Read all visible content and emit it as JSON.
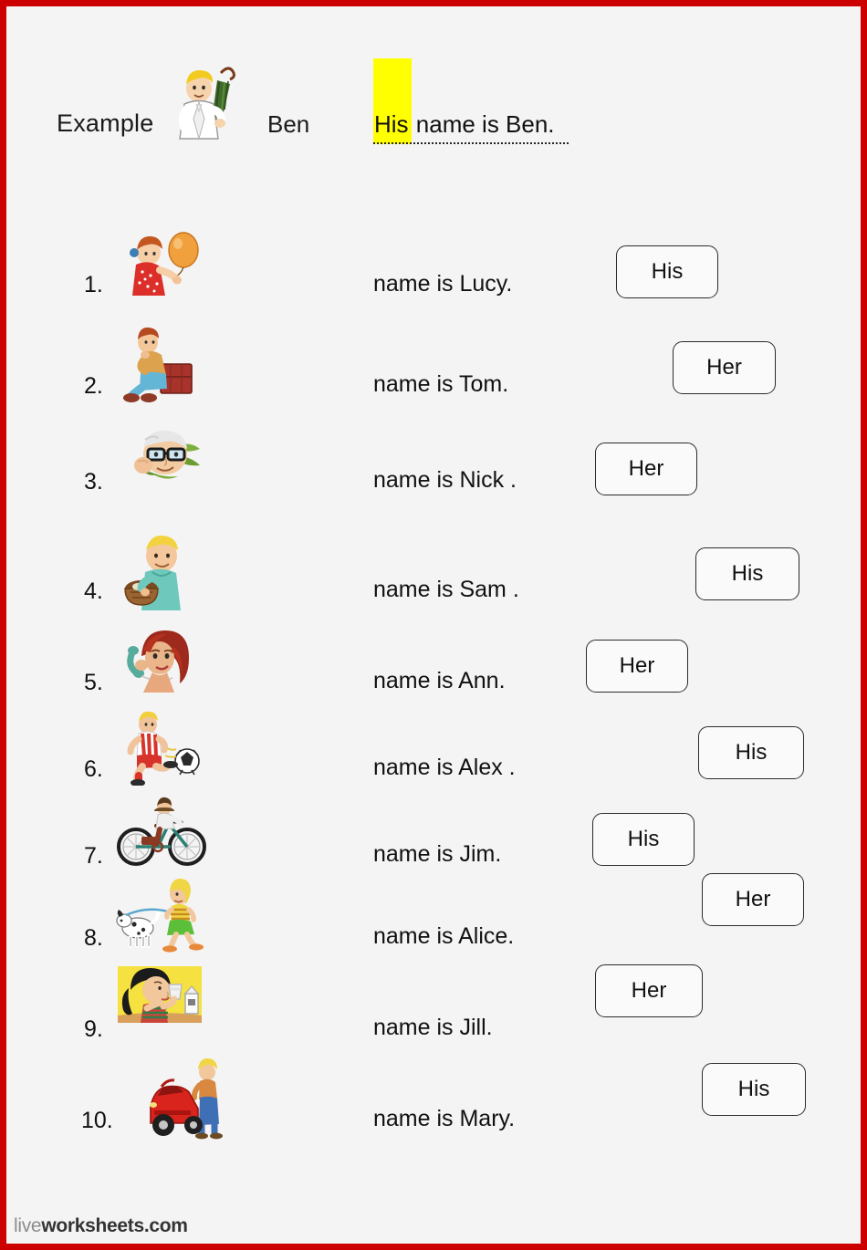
{
  "page": {
    "border_color": "#cc0000",
    "background_color": "#f4f4f4",
    "highlight_color": "#ffff00"
  },
  "example": {
    "label": "Example",
    "person_name": "Ben",
    "answer": "His",
    "sentence_rest": " name is Ben.",
    "figure": "man-with-umbrella-and-flowers"
  },
  "questions": [
    {
      "number": "1.",
      "text": "name is Lucy.",
      "answer": "His",
      "figure": "girl-with-balloon"
    },
    {
      "number": "2.",
      "text": "name is Tom.",
      "answer": "Her",
      "figure": "boy-on-suitcase"
    },
    {
      "number": "3.",
      "text": "name is Nick .",
      "answer": "Her",
      "figure": "old-man-with-glasses"
    },
    {
      "number": "4.",
      "text": "name is Sam .",
      "answer": "His",
      "figure": "boy-with-basket"
    },
    {
      "number": "5.",
      "text": "name is Ann.",
      "answer": "Her",
      "figure": "woman-on-telephone"
    },
    {
      "number": "6.",
      "text": "name is Alex .",
      "answer": "His",
      "figure": "boy-playing-soccer"
    },
    {
      "number": "7.",
      "text": "name is Jim.",
      "answer": "His",
      "figure": "person-on-bicycle"
    },
    {
      "number": "8.",
      "text": "name is Alice.",
      "answer": "Her",
      "figure": "girl-walking-dog"
    },
    {
      "number": "9.",
      "text": "name is Jill.",
      "answer": "Her",
      "figure": "girl-drinking-milk"
    },
    {
      "number": "10.",
      "text": "name is Mary.",
      "answer": "His",
      "figure": "person-with-red-car"
    }
  ],
  "footer": {
    "brand_light": "live",
    "brand_bold": "worksheets.com"
  }
}
